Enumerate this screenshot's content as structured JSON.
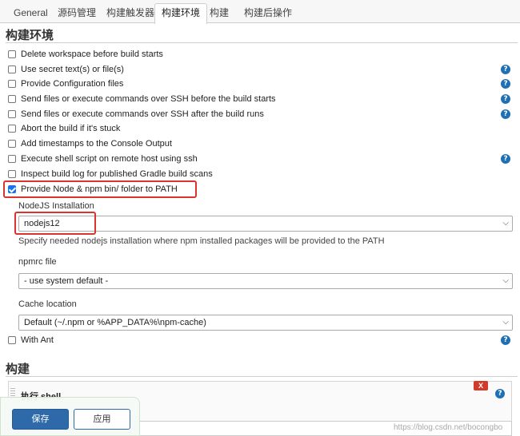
{
  "tabs": [
    "General",
    "源码管理",
    "构建触发器",
    "构建环境",
    "构建",
    "构建后操作"
  ],
  "active_tab": "构建环境",
  "section_env_title": "构建环境",
  "options": [
    {
      "label": "Delete workspace before build starts",
      "checked": false,
      "help": false
    },
    {
      "label": "Use secret text(s) or file(s)",
      "checked": false,
      "help": true
    },
    {
      "label": "Provide Configuration files",
      "checked": false,
      "help": true
    },
    {
      "label": "Send files or execute commands over SSH before the build starts",
      "checked": false,
      "help": true
    },
    {
      "label": "Send files or execute commands over SSH after the build runs",
      "checked": false,
      "help": true
    },
    {
      "label": "Abort the build if it's stuck",
      "checked": false,
      "help": false
    },
    {
      "label": "Add timestamps to the Console Output",
      "checked": false,
      "help": false
    },
    {
      "label": "Execute shell script on remote host using ssh",
      "checked": false,
      "help": true
    },
    {
      "label": "Inspect build log for published Gradle build scans",
      "checked": false,
      "help": false
    },
    {
      "label": "Provide Node & npm bin/ folder to PATH",
      "checked": true,
      "help": false
    }
  ],
  "nodejs": {
    "installation_label": "NodeJS Installation",
    "installation_value": "nodejs12",
    "installation_hint": "Specify needed nodejs installation where npm installed packages will be provided to the PATH",
    "npmrc_label": "npmrc file",
    "npmrc_value": "- use system default -",
    "cache_label": "Cache location",
    "cache_value": "Default (~/.npm or %APP_DATA%\\npm-cache)"
  },
  "with_ant": {
    "label": "With Ant",
    "checked": false
  },
  "section_build_title": "构建",
  "build_step": {
    "title": "执行 shell",
    "delete_label": "X"
  },
  "buttons": {
    "save": "保存",
    "apply": "应用"
  },
  "watermark": "https://blog.csdn.net/bocongbo",
  "colors": {
    "accent": "#2e6aaa",
    "highlight": "#d9352c",
    "help": "#1f6fb5"
  }
}
